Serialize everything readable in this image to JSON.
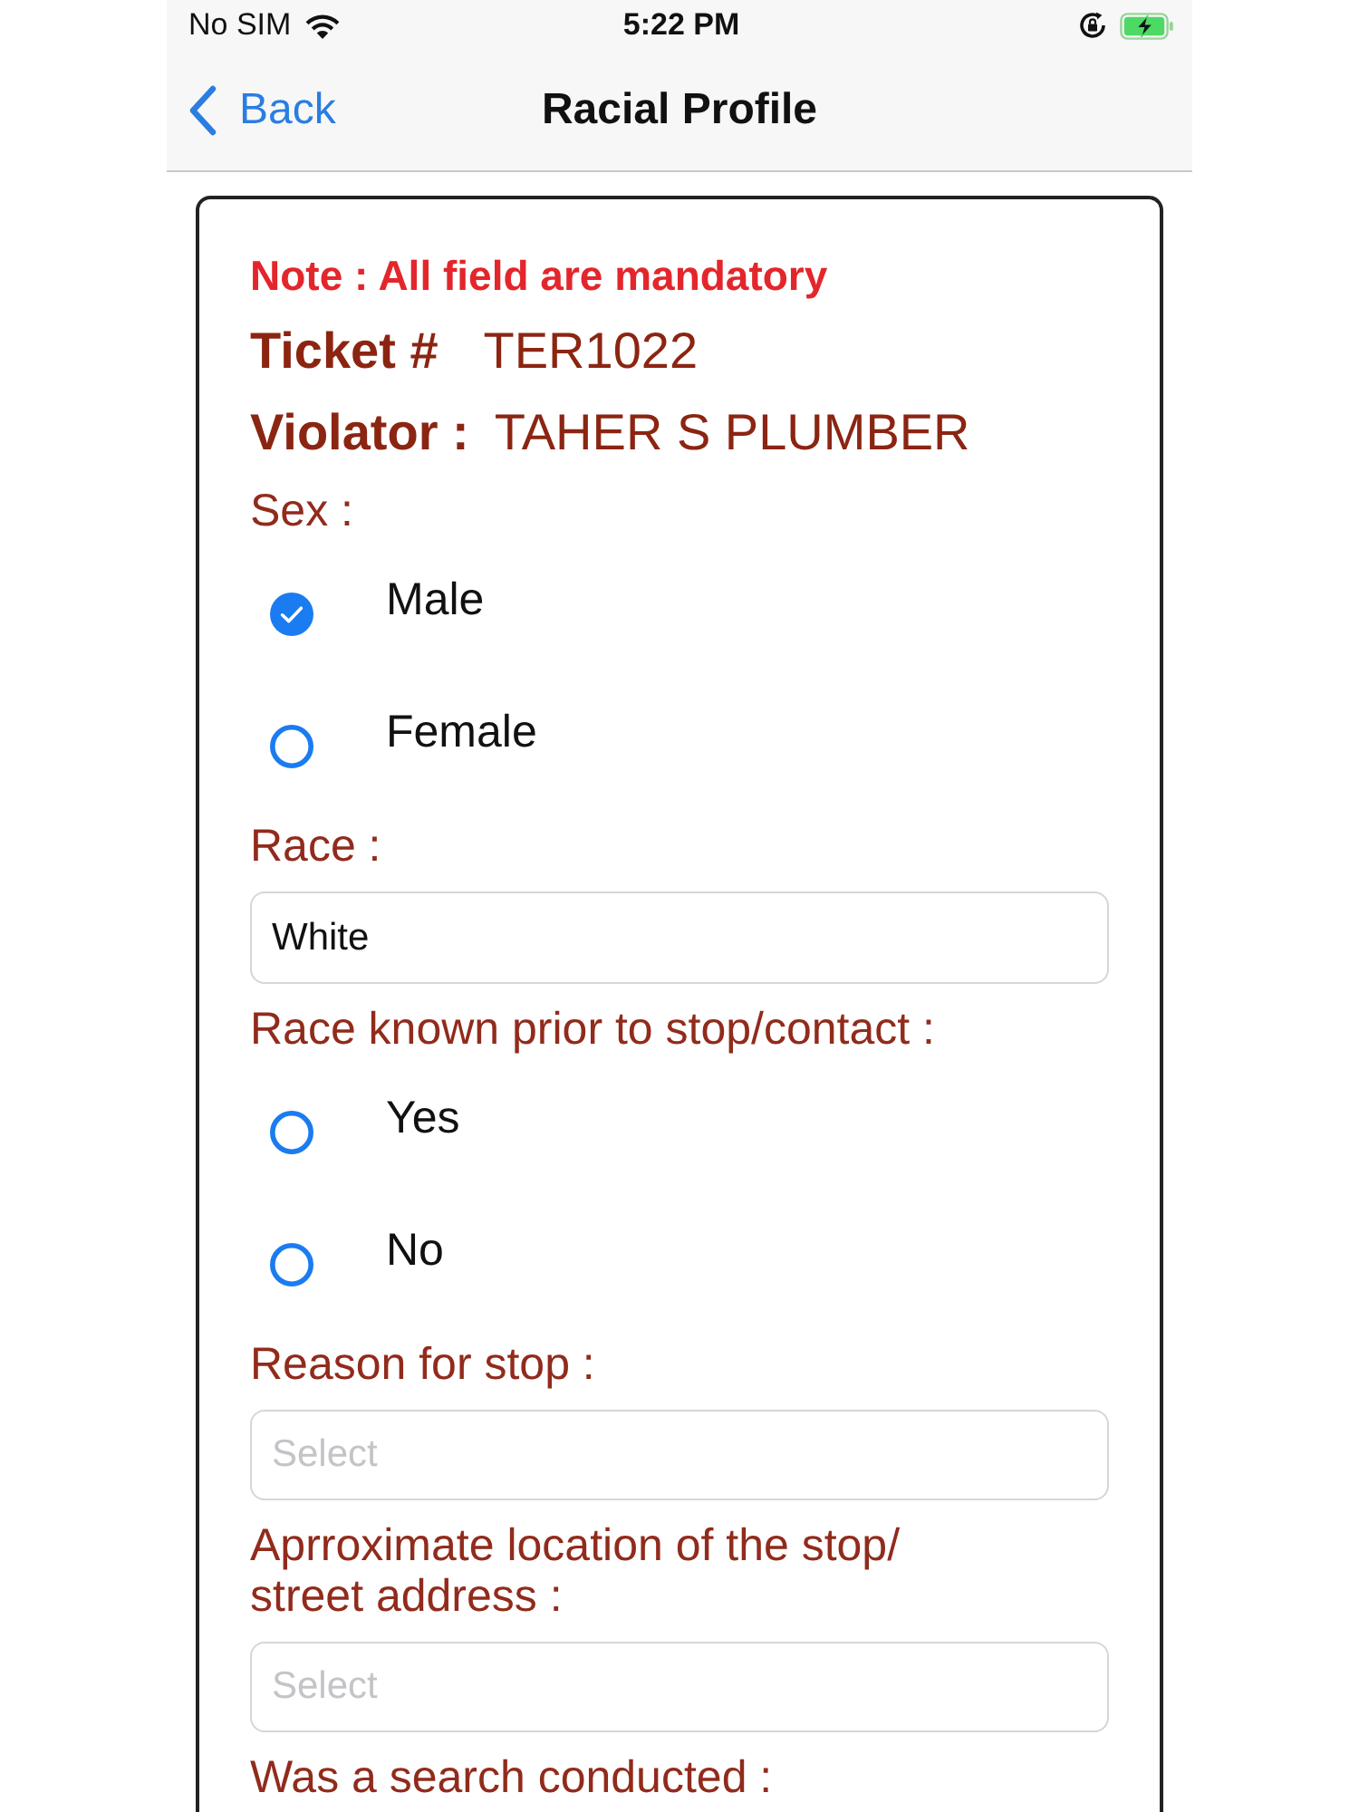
{
  "status_bar": {
    "carrier": "No SIM",
    "time": "5:22 PM"
  },
  "nav_bar": {
    "back": "Back",
    "title": "Racial Profile"
  },
  "form": {
    "note": "Note : All field are mandatory",
    "ticket": {
      "label": "Ticket #",
      "value": "TER1022"
    },
    "violator": {
      "label": "Violator :",
      "value": "TAHER S PLUMBER"
    },
    "fields": [
      {
        "kind": "radio",
        "label": "Sex :",
        "options": [
          {
            "label": "Male",
            "selected": true
          },
          {
            "label": "Female",
            "selected": false
          }
        ]
      },
      {
        "kind": "text",
        "label": "Race :",
        "value": "White"
      },
      {
        "kind": "radio",
        "label": "Race known prior to stop/contact :",
        "options": [
          {
            "label": "Yes",
            "selected": false
          },
          {
            "label": "No",
            "selected": false
          }
        ]
      },
      {
        "kind": "select",
        "label": "Reason for stop :",
        "placeholder": "Select"
      },
      {
        "kind": "select",
        "label": "Aprroximate location of the stop/ street address :",
        "placeholder": "Select"
      },
      {
        "kind": "radio",
        "label": "Was a search conducted :"
      }
    ]
  }
}
